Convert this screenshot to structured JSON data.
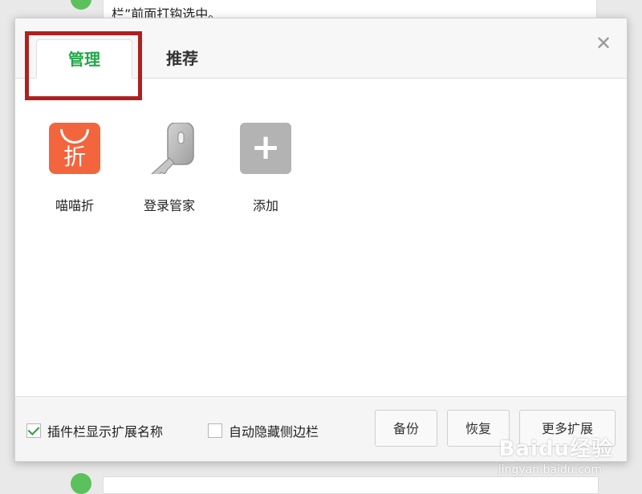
{
  "background": {
    "top_text": "栏”前面打钩选中。"
  },
  "dialog": {
    "tabs": [
      {
        "label": "管理",
        "active": true
      },
      {
        "label": "推荐",
        "active": false
      }
    ],
    "close_icon": "close-icon",
    "extensions": [
      {
        "label": "喵喵折",
        "icon_glyph": "折",
        "icon": "shopping-bag-icon",
        "color": "#f3653d"
      },
      {
        "label": "登录管家",
        "icon": "key-icon",
        "color": "#b8b8b8"
      },
      {
        "label": "添加",
        "icon": "plus-icon",
        "icon_glyph": "+",
        "color": "#b3b3b3"
      }
    ],
    "footer": {
      "show_names": {
        "label": "插件栏显示扩展名称",
        "checked": true
      },
      "auto_hide": {
        "label": "自动隐藏侧边栏",
        "checked": false
      },
      "backup_label": "备份",
      "restore_label": "恢复",
      "more_label": "更多扩展"
    },
    "accent_color": "#22a64a",
    "highlight_color": "#b01f1f"
  },
  "watermark": {
    "main": "Baidu经验",
    "sub": "jingyan.baidu.com"
  }
}
